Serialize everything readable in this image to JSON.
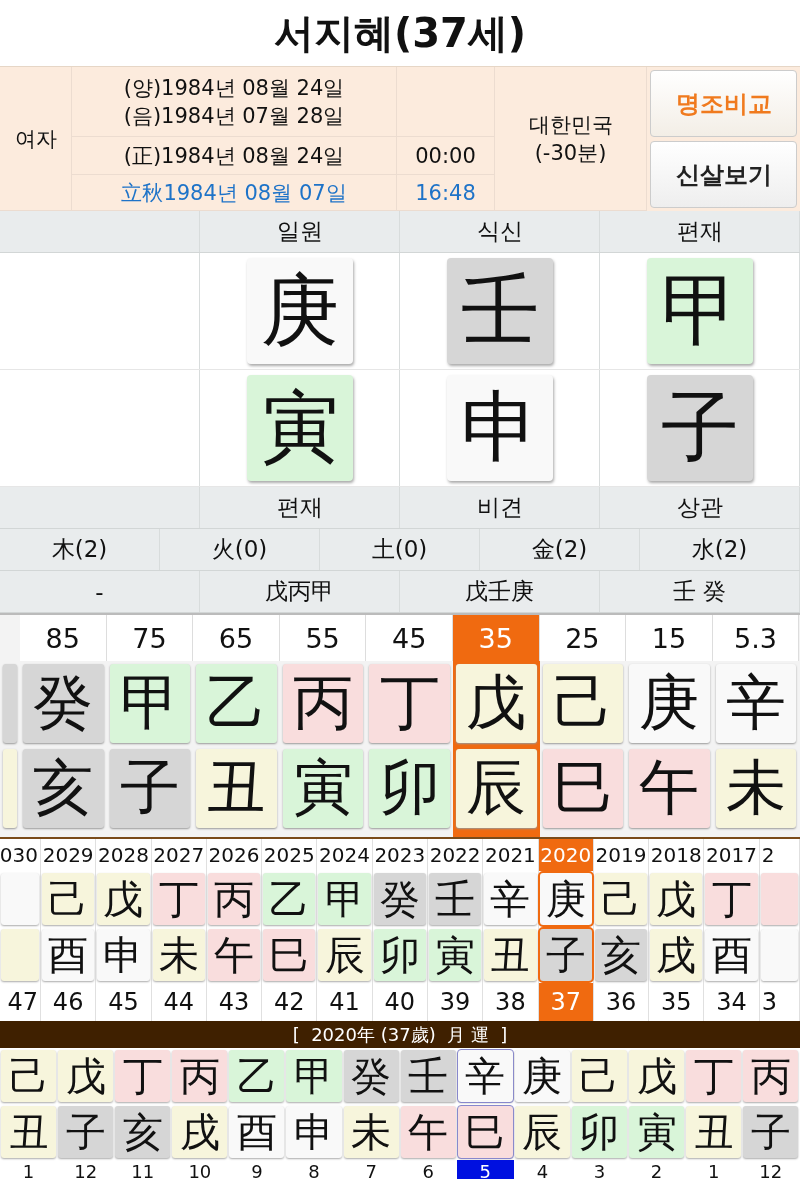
{
  "title": "서지혜(37세)",
  "info": {
    "gender": "여자",
    "solar": "(양)1984년 08월 24일",
    "lunar": "(음)1984년 07월 28일",
    "corrected": "(正)1984년 08월 24일",
    "corrected_time": "00:00",
    "term": "立秋1984년 08월 07일",
    "term_time": "16:48",
    "country": "대한민국",
    "offset": "(-30분)",
    "buttons": [
      {
        "label": "명조비교",
        "kind": "accent"
      },
      {
        "label": "신살보기",
        "kind": "plain"
      }
    ]
  },
  "pillars": [
    {
      "top": "일원",
      "stem": {
        "char": "庚",
        "color": "#f9f9f9"
      },
      "branch": {
        "char": "寅",
        "color": "#d9f5d9"
      },
      "bottom": "편재",
      "hidden": "戊丙甲"
    },
    {
      "top": "식신",
      "stem": {
        "char": "壬",
        "color": "#d6d6d6"
      },
      "branch": {
        "char": "申",
        "color": "#f9f9f9"
      },
      "bottom": "비견",
      "hidden": "戊壬庚"
    },
    {
      "top": "편재",
      "stem": {
        "char": "甲",
        "color": "#d9f5d9"
      },
      "branch": {
        "char": "子",
        "color": "#d6d6d6"
      },
      "bottom": "상관",
      "hidden": "壬 癸"
    }
  ],
  "first_hidden": "-",
  "elements": [
    "木(2)",
    "火(0)",
    "土(0)",
    "金(2)",
    "水(2)"
  ],
  "decades": [
    {
      "kind": "partial",
      "stem": {
        "color": "#d6d6d6"
      },
      "branch": {
        "color": "#f7f5dc"
      },
      "selected": false
    },
    {
      "kind": "full",
      "age": "85",
      "stem": {
        "char": "癸",
        "color": "#d6d6d6"
      },
      "branch": {
        "char": "亥",
        "color": "#d6d6d6"
      },
      "selected": false
    },
    {
      "kind": "full",
      "age": "75",
      "stem": {
        "char": "甲",
        "color": "#d9f5d9"
      },
      "branch": {
        "char": "子",
        "color": "#d6d6d6"
      },
      "selected": false
    },
    {
      "kind": "full",
      "age": "65",
      "stem": {
        "char": "乙",
        "color": "#d9f5d9"
      },
      "branch": {
        "char": "丑",
        "color": "#f7f5dc"
      },
      "selected": false
    },
    {
      "kind": "full",
      "age": "55",
      "stem": {
        "char": "丙",
        "color": "#f9dddd"
      },
      "branch": {
        "char": "寅",
        "color": "#d9f5d9"
      },
      "selected": false
    },
    {
      "kind": "full",
      "age": "45",
      "stem": {
        "char": "丁",
        "color": "#f9dddd"
      },
      "branch": {
        "char": "卯",
        "color": "#d9f5d9"
      },
      "selected": false
    },
    {
      "kind": "full",
      "age": "35",
      "stem": {
        "char": "戊",
        "color": "#f7f5dc"
      },
      "branch": {
        "char": "辰",
        "color": "#f7f5dc"
      },
      "selected": true
    },
    {
      "kind": "full",
      "age": "25",
      "stem": {
        "char": "己",
        "color": "#f7f5dc"
      },
      "branch": {
        "char": "巳",
        "color": "#f9dddd"
      },
      "selected": false
    },
    {
      "kind": "full",
      "age": "15",
      "stem": {
        "char": "庚",
        "color": "#f9f9f9"
      },
      "branch": {
        "char": "午",
        "color": "#f9dddd"
      },
      "selected": false
    },
    {
      "kind": "full",
      "age": "5.3",
      "stem": {
        "char": "辛",
        "color": "#f9f9f9"
      },
      "branch": {
        "char": "未",
        "color": "#f7f5dc"
      },
      "selected": false
    }
  ],
  "years": [
    {
      "kind": "partial",
      "year": "030",
      "age": "47",
      "stem": {
        "color": "#f9f9f9"
      },
      "branch": {
        "color": "#f7f5dc"
      },
      "selected": false
    },
    {
      "kind": "full",
      "year": "2029",
      "age": "46",
      "stem": {
        "char": "己",
        "color": "#f7f5dc"
      },
      "branch": {
        "char": "酉",
        "color": "#f9f9f9"
      },
      "selected": false
    },
    {
      "kind": "full",
      "year": "2028",
      "age": "45",
      "stem": {
        "char": "戊",
        "color": "#f7f5dc"
      },
      "branch": {
        "char": "申",
        "color": "#f9f9f9"
      },
      "selected": false
    },
    {
      "kind": "full",
      "year": "2027",
      "age": "44",
      "stem": {
        "char": "丁",
        "color": "#f9dddd"
      },
      "branch": {
        "char": "未",
        "color": "#f7f5dc"
      },
      "selected": false
    },
    {
      "kind": "full",
      "year": "2026",
      "age": "43",
      "stem": {
        "char": "丙",
        "color": "#f9dddd"
      },
      "branch": {
        "char": "午",
        "color": "#f9dddd"
      },
      "selected": false
    },
    {
      "kind": "full",
      "year": "2025",
      "age": "42",
      "stem": {
        "char": "乙",
        "color": "#d9f5d9"
      },
      "branch": {
        "char": "巳",
        "color": "#f9dddd"
      },
      "selected": false
    },
    {
      "kind": "full",
      "year": "2024",
      "age": "41",
      "stem": {
        "char": "甲",
        "color": "#d9f5d9"
      },
      "branch": {
        "char": "辰",
        "color": "#f7f5dc"
      },
      "selected": false
    },
    {
      "kind": "full",
      "year": "2023",
      "age": "40",
      "stem": {
        "char": "癸",
        "color": "#d6d6d6"
      },
      "branch": {
        "char": "卯",
        "color": "#d9f5d9"
      },
      "selected": false
    },
    {
      "kind": "full",
      "year": "2022",
      "age": "39",
      "stem": {
        "char": "壬",
        "color": "#d6d6d6"
      },
      "branch": {
        "char": "寅",
        "color": "#d9f5d9"
      },
      "selected": false
    },
    {
      "kind": "full",
      "year": "2021",
      "age": "38",
      "stem": {
        "char": "辛",
        "color": "#f9f9f9"
      },
      "branch": {
        "char": "丑",
        "color": "#f7f5dc"
      },
      "selected": false
    },
    {
      "kind": "full",
      "year": "2020",
      "age": "37",
      "stem": {
        "char": "庚",
        "color": "#f9f9f9"
      },
      "branch": {
        "char": "子",
        "color": "#d6d6d6"
      },
      "selected": true
    },
    {
      "kind": "full",
      "year": "2019",
      "age": "36",
      "stem": {
        "char": "己",
        "color": "#f7f5dc"
      },
      "branch": {
        "char": "亥",
        "color": "#d6d6d6"
      },
      "selected": false
    },
    {
      "kind": "full",
      "year": "2018",
      "age": "35",
      "stem": {
        "char": "戊",
        "color": "#f7f5dc"
      },
      "branch": {
        "char": "戌",
        "color": "#f7f5dc"
      },
      "selected": false
    },
    {
      "kind": "full",
      "year": "2017",
      "age": "34",
      "stem": {
        "char": "丁",
        "color": "#f9dddd"
      },
      "branch": {
        "char": "酉",
        "color": "#f9f9f9"
      },
      "selected": false
    },
    {
      "kind": "partial",
      "year": "2",
      "age": "3",
      "stem": {
        "color": "#f9dddd"
      },
      "branch": {
        "color": "#f9f9f9"
      },
      "selected": false
    }
  ],
  "month_banner": "[  2020年 (37歲)  月 運  ]",
  "months": [
    {
      "month": "1",
      "stem": {
        "char": "己",
        "color": "#f7f5dc"
      },
      "branch": {
        "char": "丑",
        "color": "#f7f5dc"
      },
      "selected": false
    },
    {
      "month": "12",
      "stem": {
        "char": "戊",
        "color": "#f7f5dc"
      },
      "branch": {
        "char": "子",
        "color": "#d6d6d6"
      },
      "selected": false
    },
    {
      "month": "11",
      "stem": {
        "char": "丁",
        "color": "#f9dddd"
      },
      "branch": {
        "char": "亥",
        "color": "#d6d6d6"
      },
      "selected": false
    },
    {
      "month": "10",
      "stem": {
        "char": "丙",
        "color": "#f9dddd"
      },
      "branch": {
        "char": "戌",
        "color": "#f7f5dc"
      },
      "selected": false
    },
    {
      "month": "9",
      "stem": {
        "char": "乙",
        "color": "#d9f5d9"
      },
      "branch": {
        "char": "酉",
        "color": "#f9f9f9"
      },
      "selected": false
    },
    {
      "month": "8",
      "stem": {
        "char": "甲",
        "color": "#d9f5d9"
      },
      "branch": {
        "char": "申",
        "color": "#f9f9f9"
      },
      "selected": false
    },
    {
      "month": "7",
      "stem": {
        "char": "癸",
        "color": "#d6d6d6"
      },
      "branch": {
        "char": "未",
        "color": "#f7f5dc"
      },
      "selected": false
    },
    {
      "month": "6",
      "stem": {
        "char": "壬",
        "color": "#d6d6d6"
      },
      "branch": {
        "char": "午",
        "color": "#f9dddd"
      },
      "selected": false
    },
    {
      "month": "5",
      "stem": {
        "char": "辛",
        "color": "#f9f9f9"
      },
      "branch": {
        "char": "巳",
        "color": "#f9dddd"
      },
      "selected": true
    },
    {
      "month": "4",
      "stem": {
        "char": "庚",
        "color": "#f9f9f9"
      },
      "branch": {
        "char": "辰",
        "color": "#f7f5dc"
      },
      "selected": false
    },
    {
      "month": "3",
      "stem": {
        "char": "己",
        "color": "#f7f5dc"
      },
      "branch": {
        "char": "卯",
        "color": "#d9f5d9"
      },
      "selected": false
    },
    {
      "month": "2",
      "stem": {
        "char": "戊",
        "color": "#f7f5dc"
      },
      "branch": {
        "char": "寅",
        "color": "#d9f5d9"
      },
      "selected": false
    },
    {
      "month": "1",
      "stem": {
        "char": "丁",
        "color": "#f9dddd"
      },
      "branch": {
        "char": "丑",
        "color": "#f7f5dc"
      },
      "selected": false
    },
    {
      "month": "12",
      "stem": {
        "char": "丙",
        "color": "#f9dddd"
      },
      "branch": {
        "char": "子",
        "color": "#d6d6d6"
      },
      "selected": false
    }
  ]
}
